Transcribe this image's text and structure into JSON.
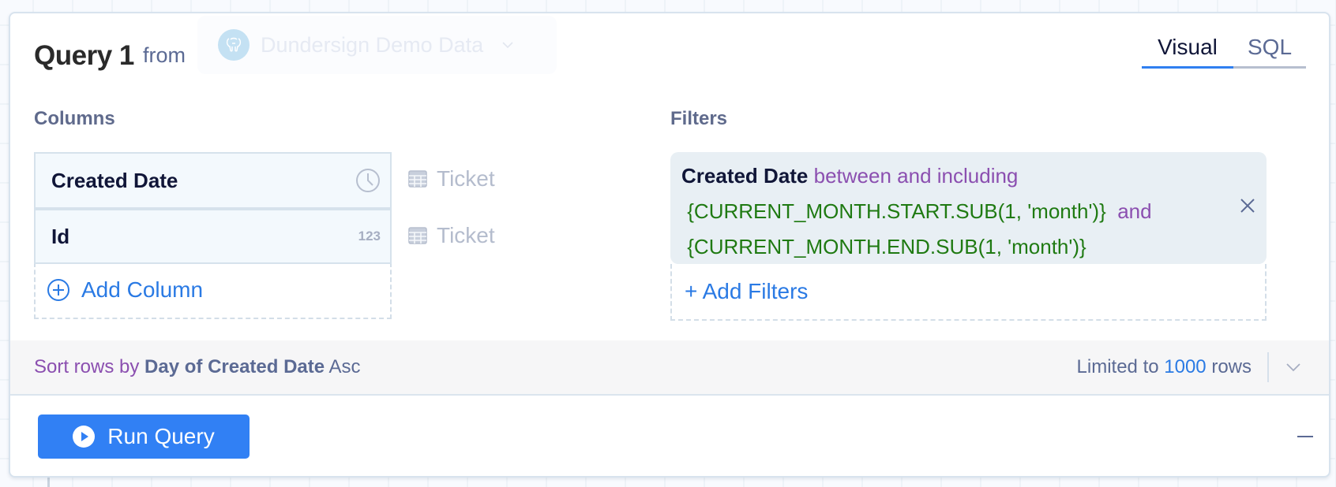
{
  "query": {
    "title": "Query 1",
    "from_label": "from",
    "datasource": "Dundersign Demo Data",
    "datasource_icon": "postgresql-elephant-icon"
  },
  "tabs": [
    {
      "label": "Visual",
      "active": true
    },
    {
      "label": "SQL",
      "active": false
    }
  ],
  "columns": {
    "label": "Columns",
    "items": [
      {
        "name": "Created Date",
        "type_icon": "clock-icon",
        "type_text": "",
        "table": "Ticket"
      },
      {
        "name": "Id",
        "type_icon": "number-icon",
        "type_text": "123",
        "table": "Ticket"
      }
    ],
    "add_label": "Add Column"
  },
  "filters": {
    "label": "Filters",
    "items": [
      {
        "field": "Created Date",
        "operator": "between and including",
        "value1": "{CURRENT_MONTH.START.SUB(1, 'month')}",
        "joiner": "and",
        "value2": "{CURRENT_MONTH.END.SUB(1, 'month')}"
      }
    ],
    "add_label": "+ Add Filters"
  },
  "sort": {
    "prefix": "Sort rows by",
    "field": "Day of Created Date",
    "direction": "Asc"
  },
  "limit": {
    "prefix": "Limited to",
    "value": "1000",
    "suffix": "rows"
  },
  "run_button": {
    "label": "Run Query"
  },
  "colors": {
    "accent": "#3180f4",
    "link": "#2a7ae4",
    "operator": "#8b4fb0",
    "value": "#1f7a12",
    "muted": "#5b6a94"
  }
}
